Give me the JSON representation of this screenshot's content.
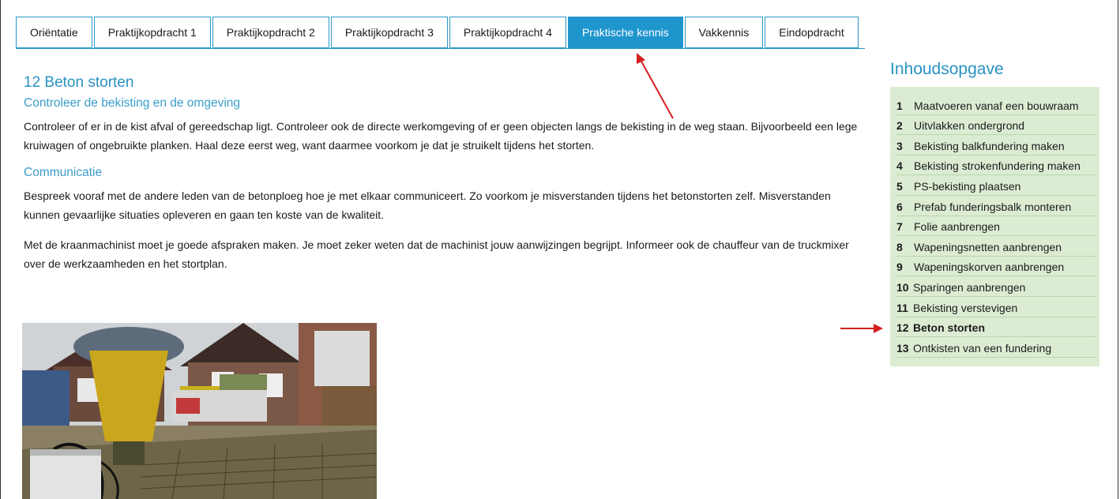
{
  "tabs": [
    {
      "label": "Oriëntatie",
      "active": false
    },
    {
      "label": "Praktijkopdracht 1",
      "active": false
    },
    {
      "label": "Praktijkopdracht 2",
      "active": false
    },
    {
      "label": "Praktijkopdracht 3",
      "active": false
    },
    {
      "label": "Praktijkopdracht 4",
      "active": false
    },
    {
      "label": "Praktische kennis",
      "active": true
    },
    {
      "label": "Vakkennis",
      "active": false
    },
    {
      "label": "Eindopdracht",
      "active": false
    }
  ],
  "main": {
    "title": "12 Beton storten",
    "section1_heading": "Controleer de bekisting en de omgeving",
    "section1_text": "Controleer of er in de kist afval of gereedschap ligt. Controleer ook de directe werkomgeving of er geen objecten langs de bekisting in de weg staan. Bijvoorbeeld een lege kruiwagen of ongebruikte planken. Haal deze eerst weg, want daarmee voorkom je dat je struikelt tijdens het storten.",
    "section2_heading": "Communicatie",
    "section2_text1": "Bespreek vooraf met de andere leden van de betonploeg hoe je met elkaar communiceert. Zo voorkom je misverstanden tijdens het betonstorten zelf. Misverstanden kunnen gevaarlijke situaties opleveren en gaan ten koste van de kwaliteit.",
    "section2_text2": "Met de kraanmachinist moet je goede afspraken maken. Je moet zeker weten dat de machinist jouw aanwijzingen begrijpt. Informeer ook de chauffeur van de truckmixer over de werkzaamheden en het stortplan."
  },
  "toc": {
    "title": "Inhoudsopgave",
    "items": [
      {
        "num": "1",
        "label": "Maatvoeren vanaf een bouwraam"
      },
      {
        "num": "2",
        "label": "Uitvlakken ondergrond"
      },
      {
        "num": "3",
        "label": "Bekisting balkfundering maken"
      },
      {
        "num": "4",
        "label": "Bekisting strokenfundering maken"
      },
      {
        "num": "5",
        "label": "PS-bekisting plaatsen"
      },
      {
        "num": "6",
        "label": "Prefab funderingsbalk monteren"
      },
      {
        "num": "7",
        "label": "Folie aanbrengen"
      },
      {
        "num": "8",
        "label": "Wapeningsnetten aanbrengen"
      },
      {
        "num": "9",
        "label": "Wapeningskorven aanbrengen"
      },
      {
        "num": "10",
        "label": "Sparingen aanbrengen"
      },
      {
        "num": "11",
        "label": "Bekisting verstevigen"
      },
      {
        "num": "12",
        "label": "Beton storten",
        "active": true
      },
      {
        "num": "13",
        "label": "Ontkisten van een fundering"
      }
    ]
  },
  "colors": {
    "accent": "#1f95ce",
    "toc_bg": "#dcecd3",
    "arrow": "#d42020"
  }
}
